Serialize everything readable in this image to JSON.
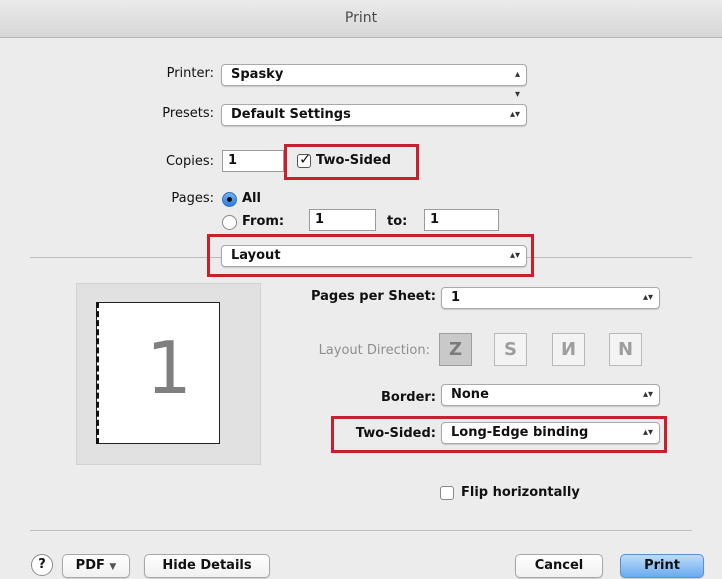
{
  "window": {
    "title": "Print"
  },
  "printer": {
    "label": "Printer:",
    "value": "Spasky"
  },
  "presets": {
    "label": "Presets:",
    "value": "Default Settings"
  },
  "copies": {
    "label": "Copies:",
    "value": "1",
    "two_sided_label": "Two-Sided",
    "two_sided_checked": true
  },
  "pages": {
    "label": "Pages:",
    "all_label": "All",
    "from_label": "From:",
    "from_value": "1",
    "to_label": "to:",
    "to_value": "1"
  },
  "section": {
    "value": "Layout"
  },
  "layout": {
    "pages_per_sheet_label": "Pages per Sheet:",
    "pages_per_sheet_value": "1",
    "layout_direction_label": "Layout Direction:",
    "border_label": "Border:",
    "border_value": "None",
    "two_sided_label": "Two-Sided:",
    "two_sided_value": "Long-Edge binding",
    "flip_label": "Flip horizontally",
    "flip_checked": false
  },
  "preview": {
    "page_number": "1"
  },
  "footer": {
    "help": "?",
    "pdf_label": "PDF",
    "hide_details": "Hide Details",
    "cancel": "Cancel",
    "print": "Print"
  },
  "icons": {
    "popup_arrows": "updown-arrows-icon",
    "check": "checkmark-icon",
    "dropdown": "chevron-down-icon",
    "direction_icons": [
      "z-order-icon",
      "reverse-z-order-icon",
      "n-order-icon",
      "reverse-n-order-icon"
    ]
  },
  "colors": {
    "highlight_red": "#c8202c",
    "accent_blue": "#4f97ec"
  }
}
